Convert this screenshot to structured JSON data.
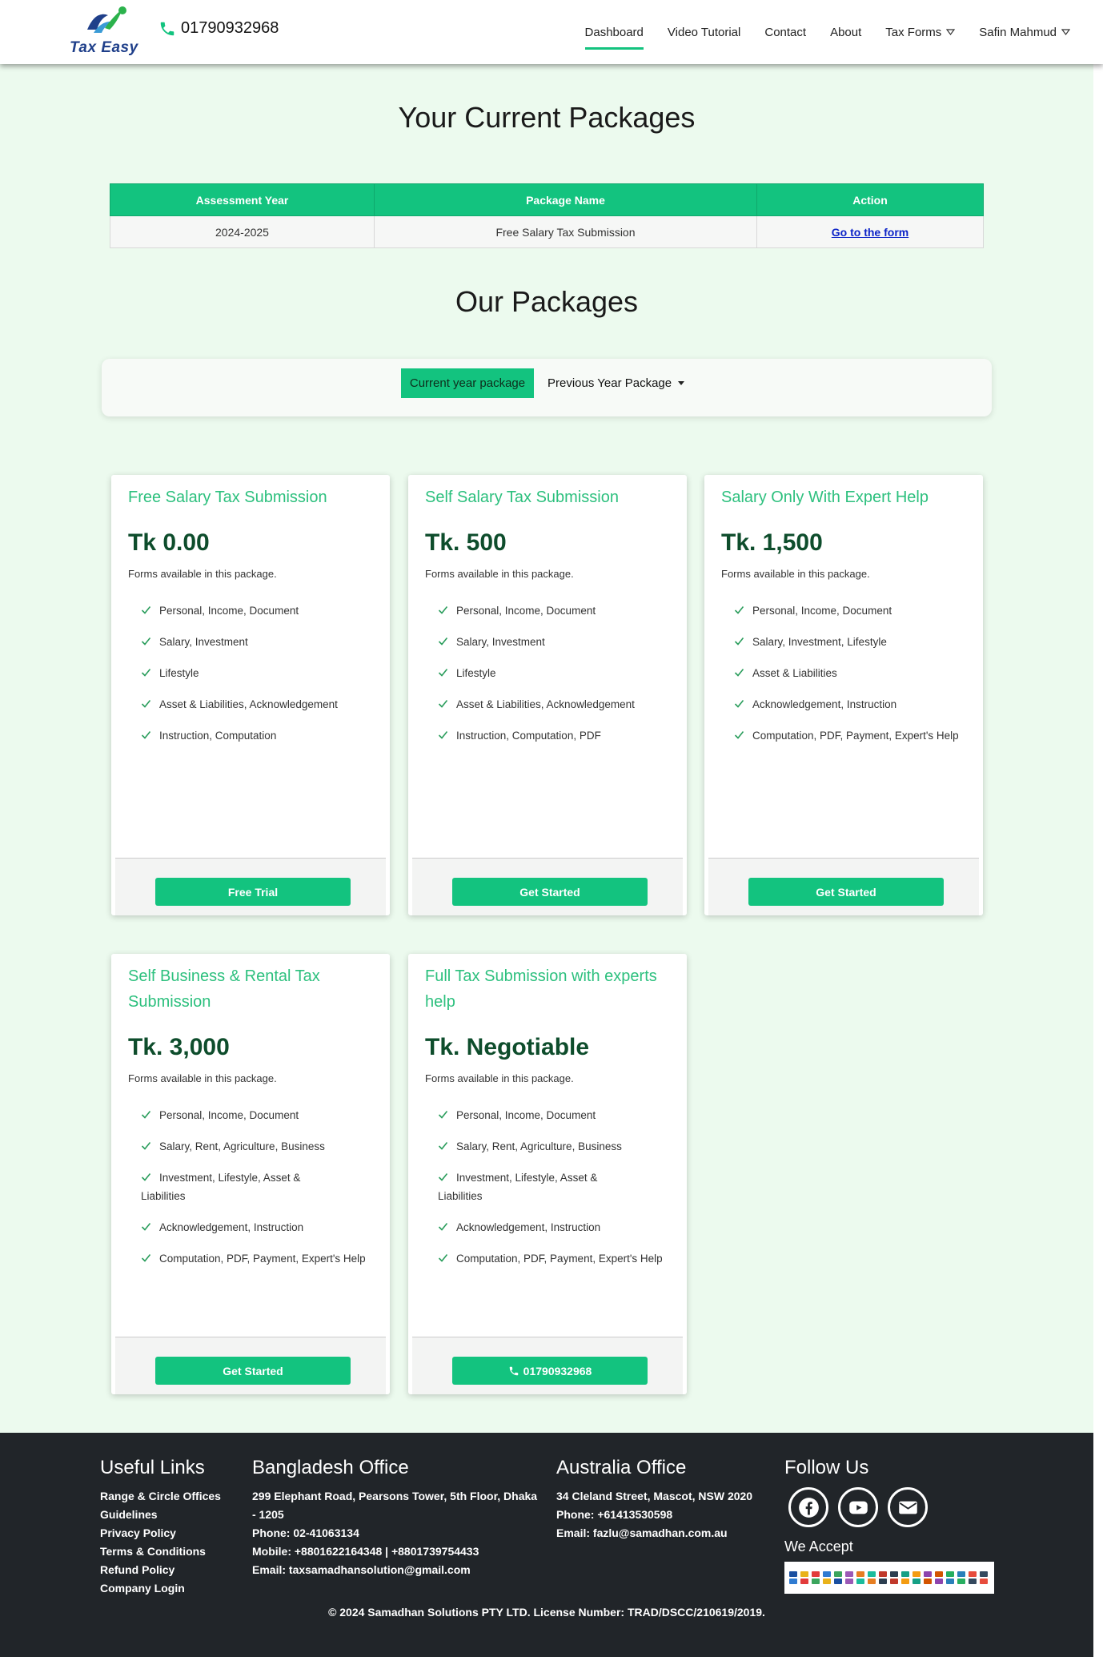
{
  "navbar": {
    "logo_text": "Tax Easy",
    "phone": "01790932968",
    "links": [
      {
        "label": "Dashboard",
        "active": true,
        "dropdown": false
      },
      {
        "label": "Video Tutorial",
        "active": false,
        "dropdown": false
      },
      {
        "label": "Contact",
        "active": false,
        "dropdown": false
      },
      {
        "label": "About",
        "active": false,
        "dropdown": false
      },
      {
        "label": "Tax Forms",
        "active": false,
        "dropdown": true
      },
      {
        "label": "Safin Mahmud",
        "active": false,
        "dropdown": true
      }
    ]
  },
  "current_packages": {
    "title": "Your Current Packages",
    "headers": [
      "Assessment Year",
      "Package Name",
      "Action"
    ],
    "rows": [
      {
        "year": "2024-2025",
        "package": "Free Salary Tax Submission",
        "action": "Go to the form"
      }
    ]
  },
  "our_packages": {
    "title": "Our Packages",
    "toggle_current": "Current year package",
    "toggle_previous": "Previous Year Package"
  },
  "cards": [
    {
      "title": "Free Salary Tax Submission",
      "price": "Tk 0.00",
      "subtitle": "Forms available in this package.",
      "features": [
        "Personal, Income, Document",
        "Salary, Investment",
        "Lifestyle",
        "Asset & Liabilities, Acknowledgement",
        "Instruction, Computation"
      ],
      "button": "Free Trial"
    },
    {
      "title": "Self Salary Tax Submission",
      "price": "Tk. 500",
      "subtitle": "Forms available in this package.",
      "features": [
        "Personal, Income, Document",
        "Salary, Investment",
        "Lifestyle",
        "Asset & Liabilities, Acknowledgement",
        "Instruction, Computation, PDF"
      ],
      "button": "Get Started"
    },
    {
      "title": "Salary Only With Expert Help",
      "price": "Tk. 1,500",
      "subtitle": "Forms available in this package.",
      "features": [
        "Personal, Income, Document",
        "Salary, Investment, Lifestyle",
        "Asset & Liabilities",
        "Acknowledgement, Instruction",
        "Computation, PDF, Payment, Expert's Help"
      ],
      "button": "Get Started"
    },
    {
      "title": "Self Business & Rental Tax Submission",
      "price": "Tk. 3,000",
      "subtitle": "Forms available in this package.",
      "features": [
        "Personal, Income, Document",
        "Salary, Rent, Agriculture, Business",
        "Investment, Lifestyle, Asset & Liabilities",
        "Acknowledgement, Instruction",
        "Computation, PDF, Payment, Expert's Help"
      ],
      "button": "Get Started"
    },
    {
      "title": "Full Tax Submission with experts help",
      "price": "Tk. Negotiable",
      "subtitle": "Forms available in this package.",
      "features": [
        "Personal, Income, Document",
        "Salary, Rent, Agriculture, Business",
        "Investment, Lifestyle, Asset & Liabilities",
        "Acknowledgement, Instruction",
        "Computation, PDF, Payment, Expert's Help"
      ],
      "button": "01790932968"
    }
  ],
  "footer": {
    "useful_links_title": "Useful Links",
    "useful_links": [
      "Range & Circle Offices",
      "Guidelines",
      "Privacy Policy",
      "Terms & Conditions",
      "Refund Policy",
      "Company Login"
    ],
    "bd_title": "Bangladesh Office",
    "bd_lines": [
      "299 Elephant Road, Pearsons Tower, 5th Floor, Dhaka - 1205",
      "Phone: 02-41063134",
      "Mobile: +8801622164348 | +8801739754433",
      "Email: taxsamadhansolution@gmail.com"
    ],
    "au_title": "Australia Office",
    "au_lines": [
      "34 Cleland Street, Mascot, NSW 2020",
      "Phone: +61413530598",
      "Email: fazlu@samadhan.com.au"
    ],
    "follow_title": "Follow Us",
    "social": [
      "facebook-icon",
      "youtube-icon",
      "envelope-icon"
    ],
    "accept_label": "We Accept",
    "copyright": "© 2024 Samadhan Solutions PTY LTD. License Number: TRAD/DSCC/210619/2019."
  },
  "colors": {
    "accent": "#13c37f",
    "title_green": "#2dc07e",
    "price_green": "#0e4d2c",
    "page_bg": "#ecfaee",
    "footer_bg": "#212529"
  }
}
